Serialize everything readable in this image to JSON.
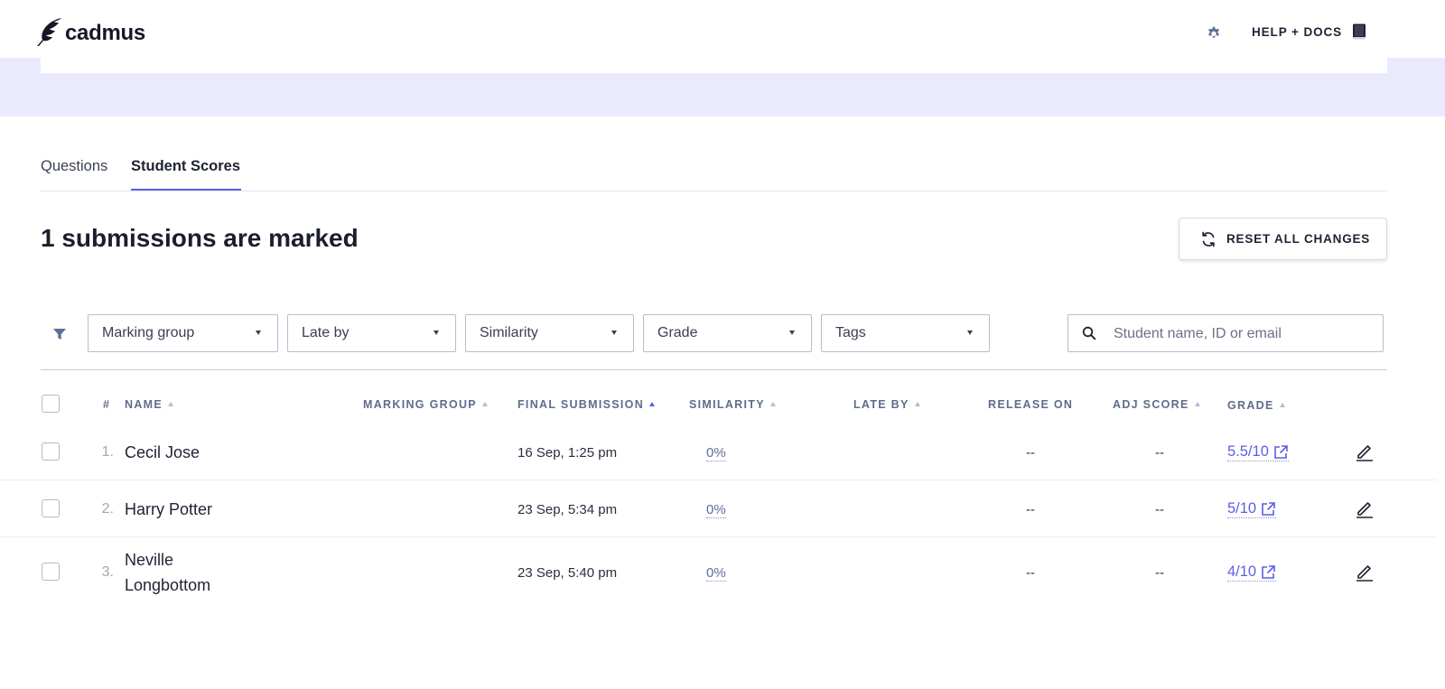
{
  "header": {
    "brand": "cadmus",
    "help_label": "HELP + DOCS"
  },
  "tabs": [
    {
      "label": "Questions",
      "active": false
    },
    {
      "label": "Student Scores",
      "active": true
    }
  ],
  "main": {
    "title": "1 submissions are marked",
    "reset_label": "RESET ALL CHANGES"
  },
  "filters": {
    "dropdowns": [
      "Marking group",
      "Late by",
      "Similarity",
      "Grade",
      "Tags"
    ],
    "search_placeholder": "Student name, ID or email"
  },
  "table": {
    "headers": {
      "num": "#",
      "name": "NAME",
      "marking_group": "MARKING GROUP",
      "final_submission": "FINAL SUBMISSION",
      "similarity": "SIMILARITY",
      "late_by": "LATE BY",
      "release_on": "RELEASE ON",
      "adj_score": "ADJ SCORE",
      "grade": "GRADE"
    },
    "rows": [
      {
        "num": "1.",
        "name": "Cecil Jose",
        "marking_group": "",
        "submission": "16 Sep, 1:25 pm",
        "similarity": "0%",
        "late_by": "",
        "release_on": "--",
        "adj_score": "--",
        "grade": "5.5/10"
      },
      {
        "num": "2.",
        "name": "Harry Potter",
        "marking_group": "",
        "submission": "23 Sep, 5:34 pm",
        "similarity": "0%",
        "late_by": "",
        "release_on": "--",
        "adj_score": "--",
        "grade": "5/10"
      },
      {
        "num": "3.",
        "name": "Neville Longbottom",
        "marking_group": "",
        "submission": "23 Sep, 5:40 pm",
        "similarity": "0%",
        "late_by": "",
        "release_on": "--",
        "adj_score": "--",
        "grade": "4/10"
      }
    ]
  },
  "colors": {
    "accent": "#5b5fe8",
    "band": "#e9ebfd",
    "header_text": "#5f6c8c"
  }
}
